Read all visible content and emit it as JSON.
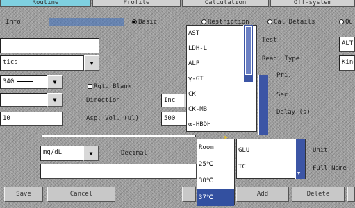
{
  "tabs": [
    "Routine",
    "Profile",
    "Calculation",
    "Off-system"
  ],
  "subtabs": {
    "info_label": "Info",
    "radios": [
      {
        "label": "Basic",
        "selected": true
      },
      {
        "label": "Restriction",
        "selected": false
      },
      {
        "label": "Cal Details",
        "selected": false
      },
      {
        "label": "Qu",
        "selected": false
      }
    ]
  },
  "left": {
    "field_row2_value": "tics",
    "wavelength_value": "340",
    "row4_value": "",
    "vol_value": "10",
    "unit_value": "mg/dL"
  },
  "middle": {
    "rgt_blank_label": "Rgt. Blank",
    "direction_label": "Direction",
    "direction_value": "Inc",
    "asp_vol_label": "Asp. Vol. (ul)",
    "asp_vol_value": "500",
    "decimal_label": "Decimal"
  },
  "test_list": {
    "items": [
      "AST",
      "LDH-L",
      "ALP",
      "γ-GT",
      "CK",
      "CK-MB",
      "α-HBDH"
    ],
    "colors": {
      "selection": "#3350a0",
      "scroll": "#3c55a5"
    }
  },
  "temp_list": {
    "items": [
      "Room",
      "25℃",
      "30℃",
      "37℃"
    ],
    "selected_index": 3
  },
  "profile_list": {
    "items": [
      "GLU",
      "TC"
    ]
  },
  "right": {
    "test_label": "Test",
    "test_value": "ALT",
    "reac_type_label": "Reac. Type",
    "reac_type_value": "Kine",
    "pri_label": "Pri.",
    "sec_label": "Sec.",
    "delay_label": "Delay (s)",
    "unit_label": "Unit",
    "full_name_label": "Full Name"
  },
  "buttons": {
    "save": "Save",
    "cancel": "Cancel",
    "add": "Add",
    "delete": "Delete"
  },
  "colors": {
    "active_tab": "#7fd0e0"
  }
}
